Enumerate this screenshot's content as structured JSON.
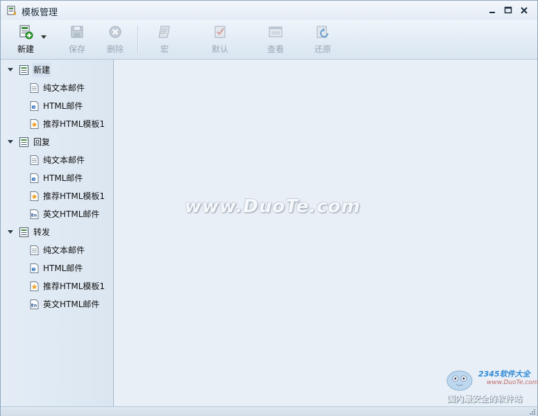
{
  "window": {
    "title": "模板管理"
  },
  "toolbar": {
    "new_label": "新建",
    "save_label": "保存",
    "delete_label": "删除",
    "macro_label": "宏",
    "default_label": "默认",
    "view_label": "查看",
    "restore_label": "还原"
  },
  "tree": {
    "groups": [
      {
        "label": "新建",
        "items": [
          {
            "label": "纯文本邮件",
            "icon": "text-doc-icon"
          },
          {
            "label": "HTML邮件",
            "icon": "html-doc-icon"
          },
          {
            "label": "推荐HTML模板1",
            "icon": "star-doc-icon"
          }
        ]
      },
      {
        "label": "回复",
        "items": [
          {
            "label": "纯文本邮件",
            "icon": "text-doc-icon"
          },
          {
            "label": "HTML邮件",
            "icon": "html-doc-icon"
          },
          {
            "label": "推荐HTML模板1",
            "icon": "star-doc-icon"
          },
          {
            "label": "英文HTML邮件",
            "icon": "english-doc-icon"
          }
        ]
      },
      {
        "label": "转发",
        "items": [
          {
            "label": "纯文本邮件",
            "icon": "text-doc-icon"
          },
          {
            "label": "HTML邮件",
            "icon": "html-doc-icon"
          },
          {
            "label": "推荐HTML模板1",
            "icon": "star-doc-icon"
          },
          {
            "label": "英文HTML邮件",
            "icon": "english-doc-icon"
          }
        ]
      }
    ]
  },
  "watermark": {
    "site": "www.DuoTe.com",
    "brand": "2345软件大全",
    "url": "www.DuoTe.com",
    "tagline": "国内最安全的软件站"
  },
  "colors": {
    "window_bg": "#dfe9f3",
    "content_bg": "#e8eff6",
    "tree_bg": "#e4edf6",
    "disabled_text": "#9aa7b4"
  }
}
